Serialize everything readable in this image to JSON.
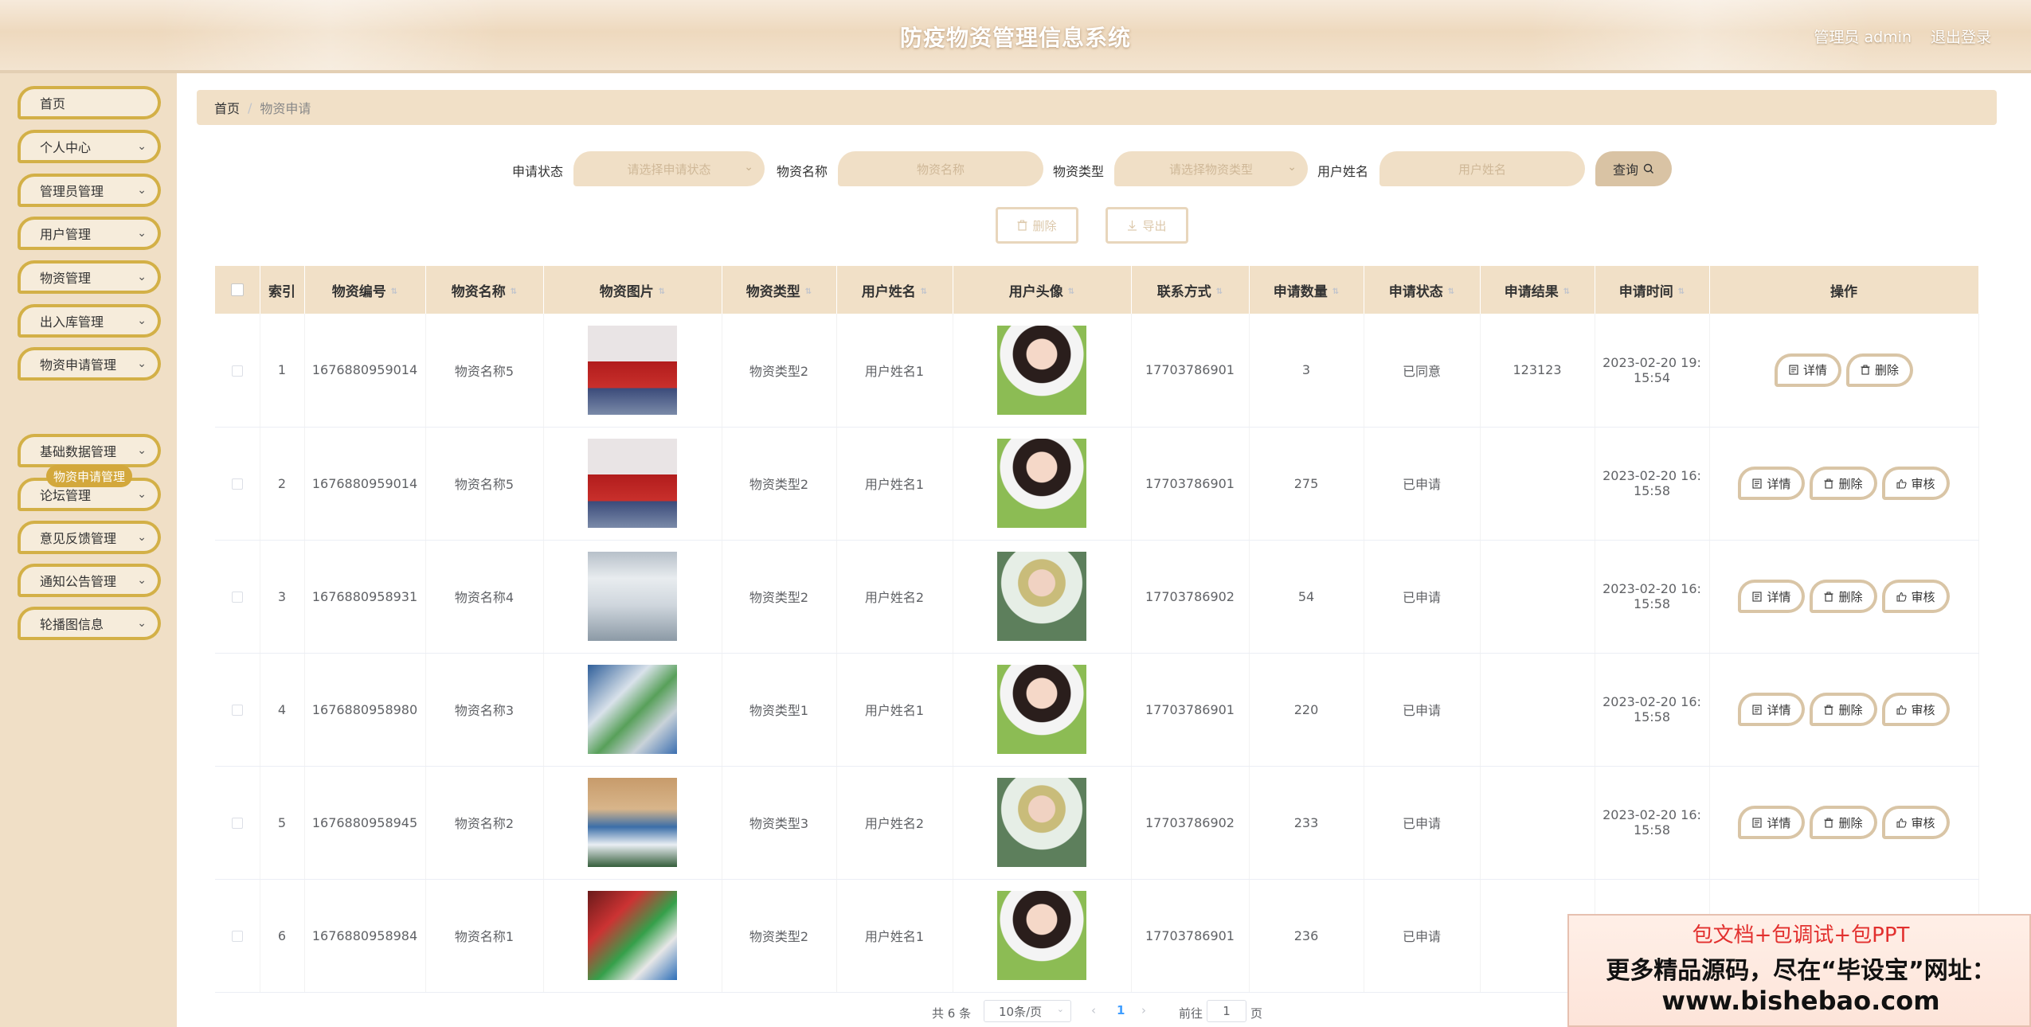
{
  "header": {
    "title": "防疫物资管理信息系统",
    "admin_label": "管理员 admin",
    "logout_label": "退出登录"
  },
  "sidebar": {
    "items": [
      {
        "label": "首页",
        "has_children": false
      },
      {
        "label": "个人中心",
        "has_children": true
      },
      {
        "label": "管理员管理",
        "has_children": true
      },
      {
        "label": "用户管理",
        "has_children": true
      },
      {
        "label": "物资管理",
        "has_children": true
      },
      {
        "label": "出入库管理",
        "has_children": true
      },
      {
        "label": "物资申请管理",
        "has_children": true
      },
      {
        "label": "基础数据管理",
        "has_children": true
      },
      {
        "label": "论坛管理",
        "has_children": true
      },
      {
        "label": "意见反馈管理",
        "has_children": true
      },
      {
        "label": "通知公告管理",
        "has_children": true
      },
      {
        "label": "轮播图信息",
        "has_children": true
      }
    ],
    "active_sub": "物资申请管理"
  },
  "breadcrumb": {
    "home": "首页",
    "separator": "/",
    "current": "物资申请"
  },
  "filters": {
    "status_label": "申请状态",
    "status_placeholder": "请选择申请状态",
    "name_label": "物资名称",
    "name_placeholder": "物资名称",
    "type_label": "物资类型",
    "type_placeholder": "请选择物资类型",
    "user_label": "用户姓名",
    "user_placeholder": "用户姓名",
    "query_label": "查询"
  },
  "actions": {
    "delete_label": "删除",
    "export_label": "导出"
  },
  "table": {
    "headers": [
      "索引",
      "物资编号",
      "物资名称",
      "物资图片",
      "物资类型",
      "用户姓名",
      "用户头像",
      "联系方式",
      "申请数量",
      "申请状态",
      "申请结果",
      "申请时间",
      "操作"
    ],
    "rows": [
      {
        "index": "1",
        "code": "1676880959014",
        "name": "物资名称5",
        "image": "goods1",
        "type": "物资类型2",
        "user": "用户姓名1",
        "avatar": "avatar-a",
        "phone": "17703786901",
        "qty": "3",
        "status": "已同意",
        "result": "123123",
        "time1": "2023-02-20 19:",
        "time2": "15:54",
        "ops": [
          "详情",
          "删除"
        ]
      },
      {
        "index": "2",
        "code": "1676880959014",
        "name": "物资名称5",
        "image": "goods1",
        "type": "物资类型2",
        "user": "用户姓名1",
        "avatar": "avatar-a",
        "phone": "17703786901",
        "qty": "275",
        "status": "已申请",
        "result": "",
        "time1": "2023-02-20 16:",
        "time2": "15:58",
        "ops": [
          "详情",
          "删除",
          "审核"
        ]
      },
      {
        "index": "3",
        "code": "1676880958931",
        "name": "物资名称4",
        "image": "goods2",
        "type": "物资类型2",
        "user": "用户姓名2",
        "avatar": "avatar-b",
        "phone": "17703786902",
        "qty": "54",
        "status": "已申请",
        "result": "",
        "time1": "2023-02-20 16:",
        "time2": "15:58",
        "ops": [
          "详情",
          "删除",
          "审核"
        ]
      },
      {
        "index": "4",
        "code": "1676880958980",
        "name": "物资名称3",
        "image": "goods3",
        "type": "物资类型1",
        "user": "用户姓名1",
        "avatar": "avatar-a",
        "phone": "17703786901",
        "qty": "220",
        "status": "已申请",
        "result": "",
        "time1": "2023-02-20 16:",
        "time2": "15:58",
        "ops": [
          "详情",
          "删除",
          "审核"
        ]
      },
      {
        "index": "5",
        "code": "1676880958945",
        "name": "物资名称2",
        "image": "goods4",
        "type": "物资类型3",
        "user": "用户姓名2",
        "avatar": "avatar-b",
        "phone": "17703786902",
        "qty": "233",
        "status": "已申请",
        "result": "",
        "time1": "2023-02-20 16:",
        "time2": "15:58",
        "ops": [
          "详情",
          "删除",
          "审核"
        ]
      },
      {
        "index": "6",
        "code": "1676880958984",
        "name": "物资名称1",
        "image": "goods5",
        "type": "物资类型2",
        "user": "用户姓名1",
        "avatar": "avatar-a",
        "phone": "17703786901",
        "qty": "236",
        "status": "已申请",
        "result": "",
        "time1": "",
        "time2": "",
        "ops": []
      }
    ]
  },
  "pagination": {
    "total": "共 6 条",
    "page_size": "10条/页",
    "current_page": "1",
    "goto_label": "前往",
    "goto_value": "1",
    "page_suffix": "页"
  },
  "ad": {
    "line1": "包文档+包调试+包PPT",
    "line2": "更多精品源码，尽在“毕设宝”网址：",
    "line3": "www.bishebao.com"
  },
  "icons": {
    "query": "search-icon",
    "delete": "trash-icon",
    "export": "download-icon",
    "detail": "document-icon",
    "audit": "thumb-up-icon",
    "sort": "sort-caret-icon",
    "chevron": "chevron-down-icon"
  },
  "colors": {
    "accent_gold": "#d3b047",
    "sidebar_bg": "#f0dfc6",
    "header_bg": "#eed9be",
    "table_header_bg": "#f1e0c7"
  }
}
